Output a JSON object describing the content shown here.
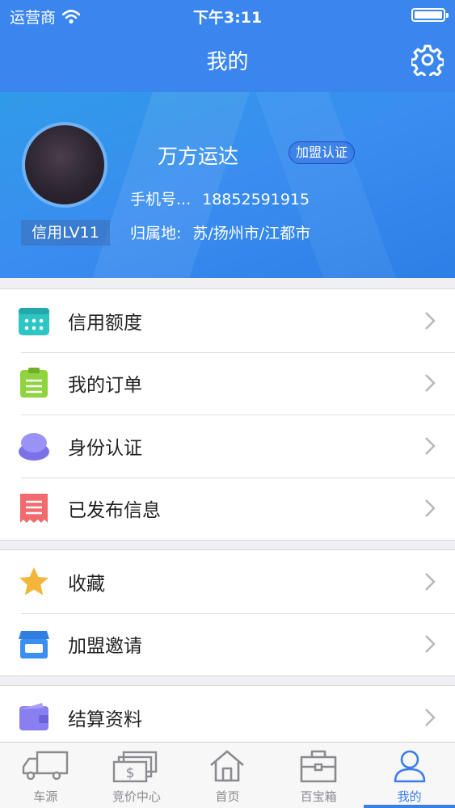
{
  "status_bar": {
    "carrier": "运营商",
    "time": "下午3:11"
  },
  "nav": {
    "title": "我的"
  },
  "profile": {
    "credit_level": "信用LV11",
    "name": "万方运达",
    "badge": "加盟认证",
    "phone_label": "手机号...",
    "phone": "18852591915",
    "location_label": "归属地:",
    "location": "苏/扬州市/江都市"
  },
  "menu_group1": [
    {
      "label": "信用额度",
      "icon": "calendar-icon",
      "color": "#2ec5c5"
    },
    {
      "label": "我的订单",
      "icon": "clipboard-icon",
      "color": "#8fd33f"
    },
    {
      "label": "身份认证",
      "icon": "user-badge-icon",
      "color": "#8a7ff0"
    },
    {
      "label": "已发布信息",
      "icon": "receipt-icon",
      "color": "#f26a6e"
    }
  ],
  "menu_group2": [
    {
      "label": "收藏",
      "icon": "star-icon",
      "color": "#f4b63a"
    },
    {
      "label": "加盟邀请",
      "icon": "store-icon",
      "color": "#3a8ff0"
    }
  ],
  "menu_group3": [
    {
      "label": "结算资料",
      "icon": "wallet-icon",
      "color": "#8a7ff0"
    }
  ],
  "tabs": [
    {
      "label": "车源",
      "icon": "truck-icon"
    },
    {
      "label": "竞价中心",
      "icon": "money-icon"
    },
    {
      "label": "首页",
      "icon": "home-icon"
    },
    {
      "label": "百宝箱",
      "icon": "toolbox-icon"
    },
    {
      "label": "我的",
      "icon": "person-icon",
      "active": true
    }
  ],
  "colors": {
    "primary": "#3a86ee",
    "active_tab": "#3a7ee8"
  }
}
